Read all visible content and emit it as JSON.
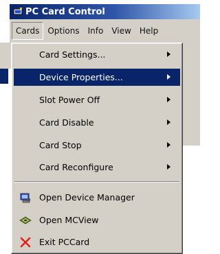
{
  "window": {
    "title": "PC Card Control"
  },
  "menubar": {
    "items": [
      {
        "label": "Cards"
      },
      {
        "label": "Options"
      },
      {
        "label": "Info"
      },
      {
        "label": "View"
      },
      {
        "label": "Help"
      }
    ]
  },
  "dropdown": {
    "items": [
      {
        "label": "Card Settings...",
        "submenu": true
      },
      {
        "label": "Device Properties...",
        "submenu": true,
        "selected": true
      },
      {
        "label": "Slot Power Off",
        "submenu": true
      },
      {
        "label": "Card Disable",
        "submenu": true
      },
      {
        "label": "Card Stop",
        "submenu": true
      },
      {
        "label": "Card Reconfigure",
        "submenu": true
      },
      {
        "label": "Open Device Manager",
        "icon": "device-manager-icon"
      },
      {
        "label": "Open MCView",
        "icon": "mcview-icon"
      },
      {
        "label": "Exit PCCard",
        "icon": "exit-x-icon"
      }
    ]
  },
  "colors": {
    "selection": "#0a246a",
    "menu_bg": "#d4d0c8",
    "exit_icon": "#e02020"
  }
}
